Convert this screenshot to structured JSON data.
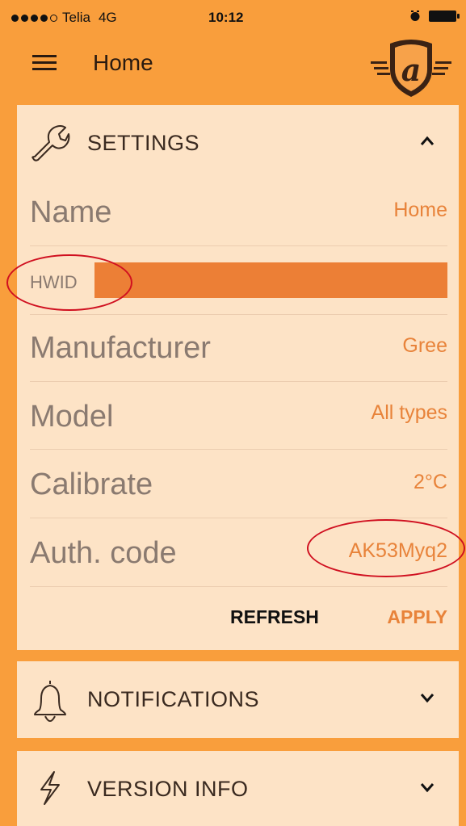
{
  "status_bar": {
    "carrier": "Telia",
    "network": "4G",
    "time": "10:12"
  },
  "nav": {
    "title": "Home"
  },
  "settings": {
    "title": "SETTINGS",
    "rows": [
      {
        "label": "Name",
        "value": "Home"
      },
      {
        "label": "HWID",
        "value": ""
      },
      {
        "label": "Manufacturer",
        "value": "Gree"
      },
      {
        "label": "Model",
        "value": "All types"
      },
      {
        "label": "Calibrate",
        "value": "2°C"
      },
      {
        "label": "Auth. code",
        "value": "AK53Myq2"
      }
    ],
    "refresh_label": "REFRESH",
    "apply_label": "APPLY"
  },
  "notifications": {
    "title": "NOTIFICATIONS"
  },
  "version_info": {
    "title": "VERSION INFO"
  },
  "colors": {
    "background": "#f99e3c",
    "card": "#fde3c6",
    "accent": "#e8833a",
    "annotation": "#d01020"
  }
}
